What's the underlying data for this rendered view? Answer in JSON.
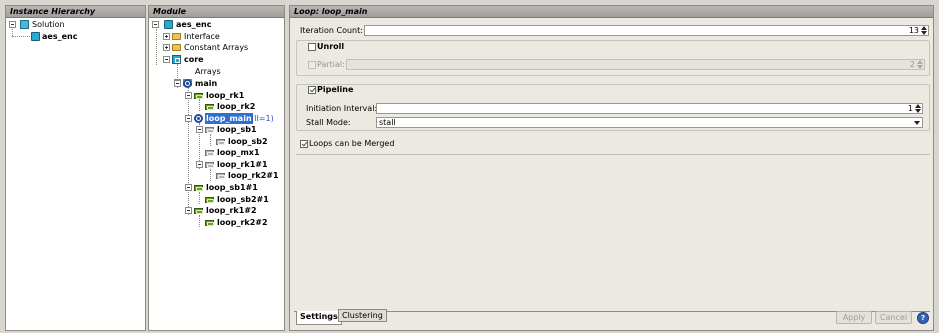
{
  "instance_panel": {
    "title": "Instance Hierarchy",
    "items": [
      {
        "label": "Solution"
      },
      {
        "label": "aes_enc"
      }
    ]
  },
  "module_panel": {
    "title": "Module",
    "items": [
      {
        "label": "aes_enc"
      },
      {
        "label": "Interface"
      },
      {
        "label": "Constant Arrays"
      },
      {
        "label": "core"
      },
      {
        "label": "Arrays"
      },
      {
        "label": "main"
      },
      {
        "label": "loop_rk1"
      },
      {
        "label": "loop_rk2"
      },
      {
        "label": "loop_main",
        "badge": "(II=1)"
      },
      {
        "label": "loop_sb1"
      },
      {
        "label": "loop_sb2"
      },
      {
        "label": "loop_mx1"
      },
      {
        "label": "loop_rk1#1"
      },
      {
        "label": "loop_rk2#1"
      },
      {
        "label": "loop_sb1#1"
      },
      {
        "label": "loop_sb2#1"
      },
      {
        "label": "loop_rk1#2"
      },
      {
        "label": "loop_rk2#2"
      }
    ]
  },
  "detail_panel": {
    "title": "Loop: loop_main",
    "iteration_count_label": "Iteration Count:",
    "iteration_count_value": "13",
    "unroll_label": "Unroll",
    "partial_label": "Partial:",
    "partial_value": "2",
    "pipeline_label": "Pipeline",
    "initiation_interval_label": "Initiation Interval:",
    "initiation_interval_value": "1",
    "stall_mode_label": "Stall Mode:",
    "stall_mode_value": "stall",
    "loops_merged_label": "Loops can be Merged"
  },
  "tabs": {
    "settings": "Settings",
    "clustering": "Clustering"
  },
  "buttons": {
    "apply": "Apply",
    "cancel": "Cancel",
    "help": "?"
  }
}
